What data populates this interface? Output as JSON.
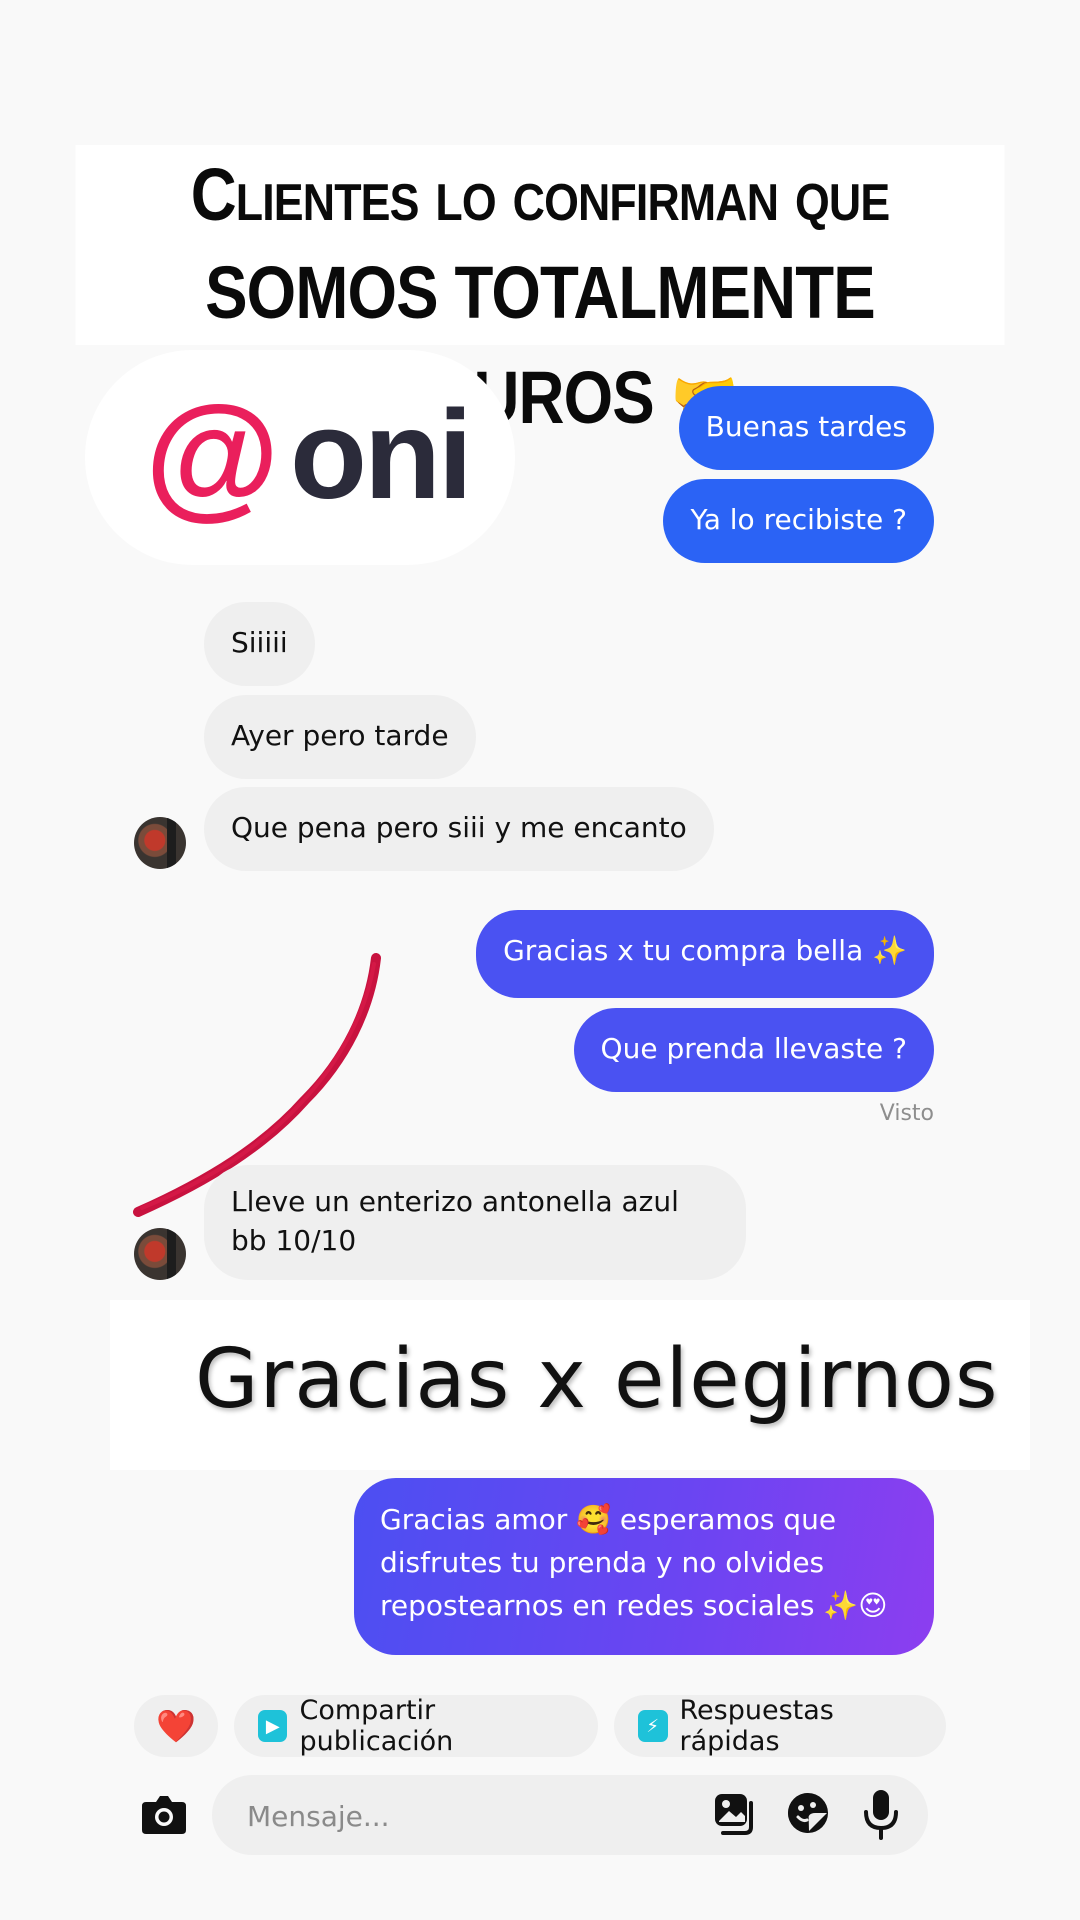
{
  "headline": {
    "line1": "Clientes lo confirman que",
    "line2": "somos totalmente seguros",
    "emoji": "🤝"
  },
  "logo": {
    "symbol": "@",
    "name": "oni"
  },
  "messages": {
    "m1": "Buenas tardes",
    "m2": "Ya lo recibiste ?",
    "m3": "Siiiii",
    "m4": "Ayer pero tarde",
    "m5": "Que pena pero siii y me encanto",
    "m6": "Gracias x tu compra bella ✨",
    "m7": "Que prenda llevaste ?",
    "seen": "Visto",
    "m8": "Lleve un enterizo antonella azul bb 10/10",
    "m9": "Gracias amor 🥰 esperamos que disfrutes tu prenda y no olvides repostearnos en redes sociales ✨😍"
  },
  "slogan": "Gracias x elegirnos",
  "quick_actions": {
    "heart": "❤️",
    "share": "Compartir publicación",
    "quick_replies": "Respuestas rápidas"
  },
  "composer": {
    "placeholder": "Mensaje..."
  },
  "colors": {
    "outgoing": "#2b63f5",
    "incoming": "#efefef",
    "logo_accent": "#ea1f5c",
    "scribble": "#c8123f"
  },
  "icons": [
    "camera-icon",
    "gallery-icon",
    "sticker-icon",
    "microphone-icon",
    "heart-icon",
    "share-post-icon",
    "quick-reply-icon"
  ]
}
